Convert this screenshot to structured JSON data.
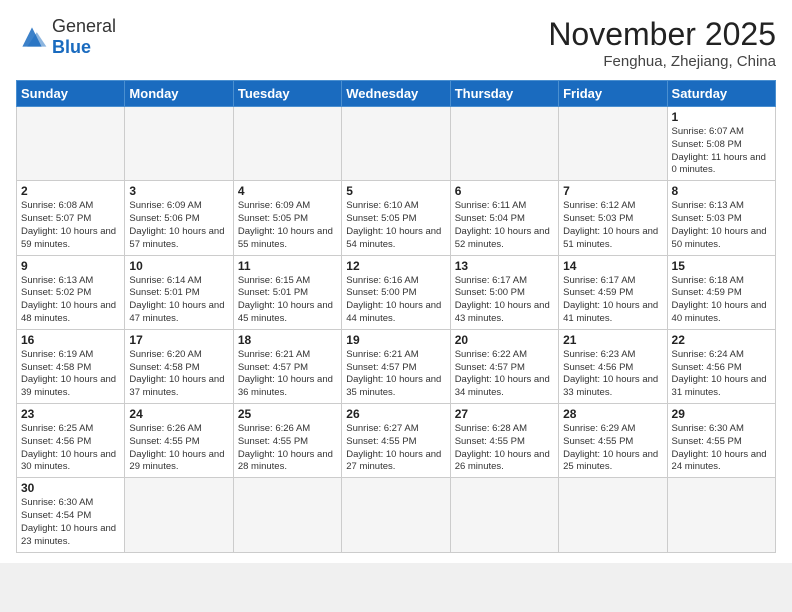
{
  "header": {
    "logo_general": "General",
    "logo_blue": "Blue",
    "month_year": "November 2025",
    "location": "Fenghua, Zhejiang, China"
  },
  "weekdays": [
    "Sunday",
    "Monday",
    "Tuesday",
    "Wednesday",
    "Thursday",
    "Friday",
    "Saturday"
  ],
  "weeks": [
    [
      {
        "day": null
      },
      {
        "day": null
      },
      {
        "day": null
      },
      {
        "day": null
      },
      {
        "day": null
      },
      {
        "day": null
      },
      {
        "day": "1",
        "sunrise": "6:07 AM",
        "sunset": "5:08 PM",
        "daylight": "11 hours and 0 minutes."
      }
    ],
    [
      {
        "day": "2",
        "sunrise": "6:08 AM",
        "sunset": "5:07 PM",
        "daylight": "10 hours and 59 minutes."
      },
      {
        "day": "3",
        "sunrise": "6:09 AM",
        "sunset": "5:06 PM",
        "daylight": "10 hours and 57 minutes."
      },
      {
        "day": "4",
        "sunrise": "6:09 AM",
        "sunset": "5:05 PM",
        "daylight": "10 hours and 55 minutes."
      },
      {
        "day": "5",
        "sunrise": "6:10 AM",
        "sunset": "5:05 PM",
        "daylight": "10 hours and 54 minutes."
      },
      {
        "day": "6",
        "sunrise": "6:11 AM",
        "sunset": "5:04 PM",
        "daylight": "10 hours and 52 minutes."
      },
      {
        "day": "7",
        "sunrise": "6:12 AM",
        "sunset": "5:03 PM",
        "daylight": "10 hours and 51 minutes."
      },
      {
        "day": "8",
        "sunrise": "6:13 AM",
        "sunset": "5:03 PM",
        "daylight": "10 hours and 50 minutes."
      }
    ],
    [
      {
        "day": "9",
        "sunrise": "6:13 AM",
        "sunset": "5:02 PM",
        "daylight": "10 hours and 48 minutes."
      },
      {
        "day": "10",
        "sunrise": "6:14 AM",
        "sunset": "5:01 PM",
        "daylight": "10 hours and 47 minutes."
      },
      {
        "day": "11",
        "sunrise": "6:15 AM",
        "sunset": "5:01 PM",
        "daylight": "10 hours and 45 minutes."
      },
      {
        "day": "12",
        "sunrise": "6:16 AM",
        "sunset": "5:00 PM",
        "daylight": "10 hours and 44 minutes."
      },
      {
        "day": "13",
        "sunrise": "6:17 AM",
        "sunset": "5:00 PM",
        "daylight": "10 hours and 43 minutes."
      },
      {
        "day": "14",
        "sunrise": "6:17 AM",
        "sunset": "4:59 PM",
        "daylight": "10 hours and 41 minutes."
      },
      {
        "day": "15",
        "sunrise": "6:18 AM",
        "sunset": "4:59 PM",
        "daylight": "10 hours and 40 minutes."
      }
    ],
    [
      {
        "day": "16",
        "sunrise": "6:19 AM",
        "sunset": "4:58 PM",
        "daylight": "10 hours and 39 minutes."
      },
      {
        "day": "17",
        "sunrise": "6:20 AM",
        "sunset": "4:58 PM",
        "daylight": "10 hours and 37 minutes."
      },
      {
        "day": "18",
        "sunrise": "6:21 AM",
        "sunset": "4:57 PM",
        "daylight": "10 hours and 36 minutes."
      },
      {
        "day": "19",
        "sunrise": "6:21 AM",
        "sunset": "4:57 PM",
        "daylight": "10 hours and 35 minutes."
      },
      {
        "day": "20",
        "sunrise": "6:22 AM",
        "sunset": "4:57 PM",
        "daylight": "10 hours and 34 minutes."
      },
      {
        "day": "21",
        "sunrise": "6:23 AM",
        "sunset": "4:56 PM",
        "daylight": "10 hours and 33 minutes."
      },
      {
        "day": "22",
        "sunrise": "6:24 AM",
        "sunset": "4:56 PM",
        "daylight": "10 hours and 31 minutes."
      }
    ],
    [
      {
        "day": "23",
        "sunrise": "6:25 AM",
        "sunset": "4:56 PM",
        "daylight": "10 hours and 30 minutes."
      },
      {
        "day": "24",
        "sunrise": "6:26 AM",
        "sunset": "4:55 PM",
        "daylight": "10 hours and 29 minutes."
      },
      {
        "day": "25",
        "sunrise": "6:26 AM",
        "sunset": "4:55 PM",
        "daylight": "10 hours and 28 minutes."
      },
      {
        "day": "26",
        "sunrise": "6:27 AM",
        "sunset": "4:55 PM",
        "daylight": "10 hours and 27 minutes."
      },
      {
        "day": "27",
        "sunrise": "6:28 AM",
        "sunset": "4:55 PM",
        "daylight": "10 hours and 26 minutes."
      },
      {
        "day": "28",
        "sunrise": "6:29 AM",
        "sunset": "4:55 PM",
        "daylight": "10 hours and 25 minutes."
      },
      {
        "day": "29",
        "sunrise": "6:30 AM",
        "sunset": "4:55 PM",
        "daylight": "10 hours and 24 minutes."
      }
    ],
    [
      {
        "day": "30",
        "sunrise": "6:30 AM",
        "sunset": "4:54 PM",
        "daylight": "10 hours and 23 minutes."
      },
      {
        "day": null
      },
      {
        "day": null
      },
      {
        "day": null
      },
      {
        "day": null
      },
      {
        "day": null
      },
      {
        "day": null
      }
    ]
  ]
}
